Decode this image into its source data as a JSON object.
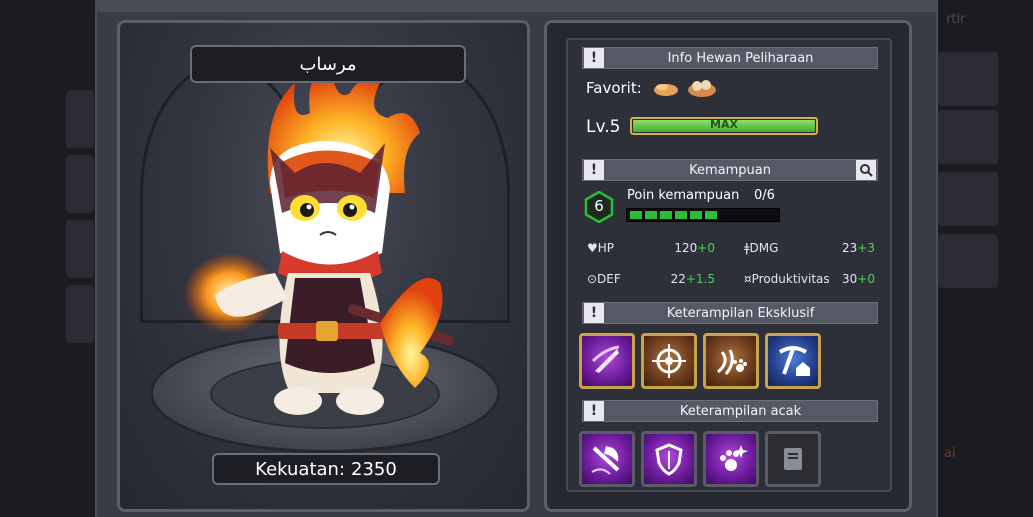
{
  "pet": {
    "name": "مرساب",
    "power_label": "Kekuatan:",
    "power_value": "2350"
  },
  "info": {
    "header": "Info Hewan Peliharaan",
    "favorite_label": "Favorit:",
    "level_label": "Lv.5",
    "level_bar_text": "MAX",
    "level_progress": 1.0
  },
  "ability": {
    "header": "Kemampuan",
    "points_value": "6",
    "points_label": "Poin kemampuan",
    "points_count": "0/6",
    "points_filled": 6,
    "points_total": 6,
    "stats": [
      {
        "icon": "heart-icon",
        "label": "♥HP",
        "base": "120",
        "bonus": "+0"
      },
      {
        "icon": "sword-icon",
        "label": "ǂDMG",
        "base": "23",
        "bonus": "+3"
      },
      {
        "icon": "shield-icon",
        "label": "⊙DEF",
        "base": "22",
        "bonus": "+1.5"
      },
      {
        "icon": "productivity-icon",
        "label": "¤Produktivitas",
        "base": "30",
        "bonus": "+0"
      }
    ]
  },
  "exclusive": {
    "header": "Keterampilan Eksklusif",
    "skills": [
      "slash-skill-icon",
      "target-skill-icon",
      "dna-paw-skill-icon",
      "pickaxe-home-skill-icon"
    ]
  },
  "random": {
    "header": "Keterampilan acak",
    "skills": [
      "axe-skill-icon",
      "shield-skill-icon",
      "paw-sparkle-skill-icon",
      "book-skill-icon"
    ]
  },
  "colors": {
    "accent_green": "#44d94a",
    "gold_border": "#c9a34a",
    "panel_bg": "#2e3039"
  },
  "background": {
    "right_text_1": "rtir",
    "right_text_2": "ai"
  }
}
